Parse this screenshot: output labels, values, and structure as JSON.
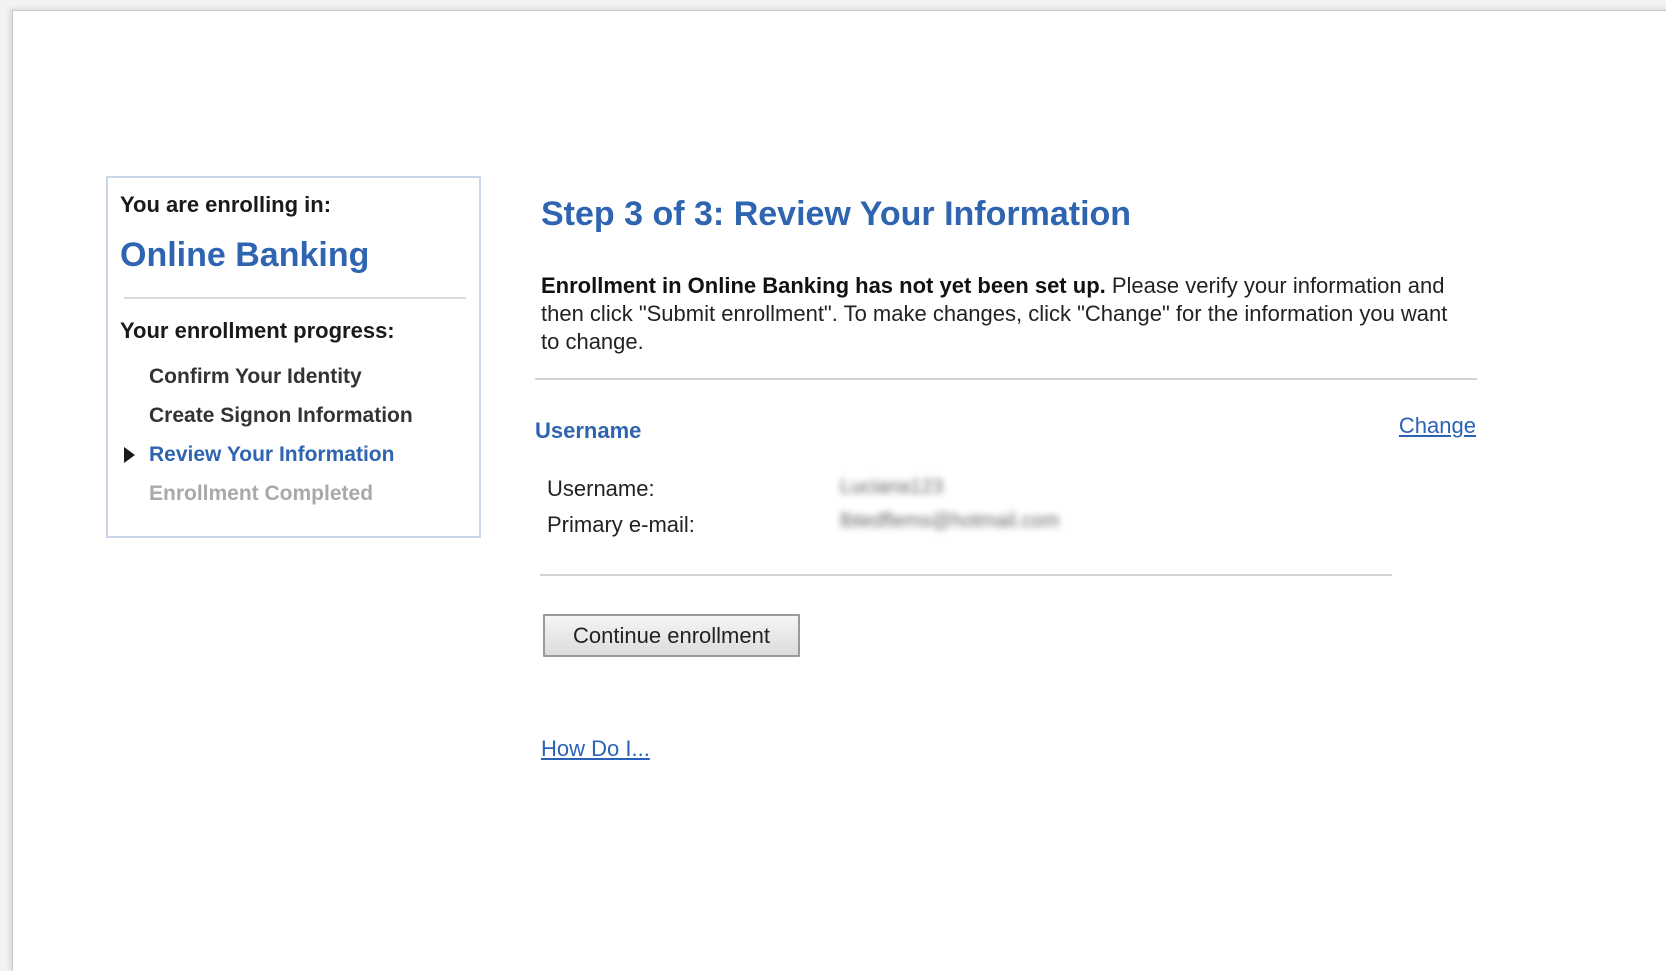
{
  "sidebar": {
    "enrolling_label": "You are enrolling in:",
    "product": "Online Banking",
    "progress_label": "Your enrollment progress:",
    "steps": [
      {
        "label": "Confirm Your Identity",
        "state": "completed"
      },
      {
        "label": "Create Signon Information",
        "state": "completed"
      },
      {
        "label": "Review Your Information",
        "state": "current"
      },
      {
        "label": "Enrollment Completed",
        "state": "pending"
      }
    ]
  },
  "main": {
    "title": "Step 3 of 3: Review Your Information",
    "intro_bold": "Enrollment in Online Banking has not yet been set up.",
    "intro_text": " Please verify your information and then click \"Submit enrollment\". To make changes, click \"Change\" for the information you want to change.",
    "section": {
      "title": "Username",
      "change_link": "Change",
      "fields": [
        {
          "label": "Username:",
          "value": "Luciana123"
        },
        {
          "label": "Primary e-mail:",
          "value": "lbtedflems@hotmail.com"
        }
      ]
    },
    "continue_button": "Continue enrollment",
    "help_link": "How Do I..."
  },
  "colors": {
    "accent": "#2f64b0",
    "link": "#2a62b8",
    "box_border": "#c9d7e8",
    "pending": "#a9a9a9"
  }
}
